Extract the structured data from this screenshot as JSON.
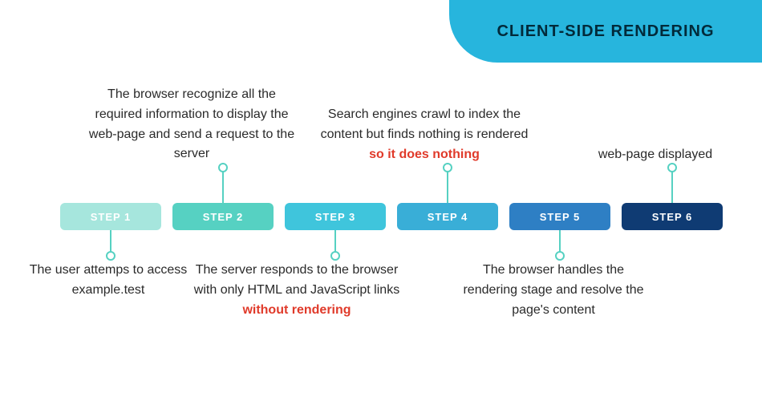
{
  "title": "CLIENT-SIDE RENDERING",
  "steps": [
    {
      "label": "STEP 1",
      "desc": "The user attemps to access example.test"
    },
    {
      "label": "STEP 2",
      "desc_pre": "The browser recognize all the required information to display the web-page and send a request to the server"
    },
    {
      "label": "STEP 3",
      "desc_pre": "The server responds to the browser with only HTML and JavaScript links ",
      "desc_red": "without rendering"
    },
    {
      "label": "STEP 4",
      "desc_pre": "Search engines crawl to index the content but finds nothing is rendered ",
      "desc_red": "so it does not​hing"
    },
    {
      "label": "STEP 5",
      "desc": "The browser handles the rendering stage and resolve the page's content"
    },
    {
      "label": "STEP 6",
      "desc": "web-page displayed"
    }
  ]
}
